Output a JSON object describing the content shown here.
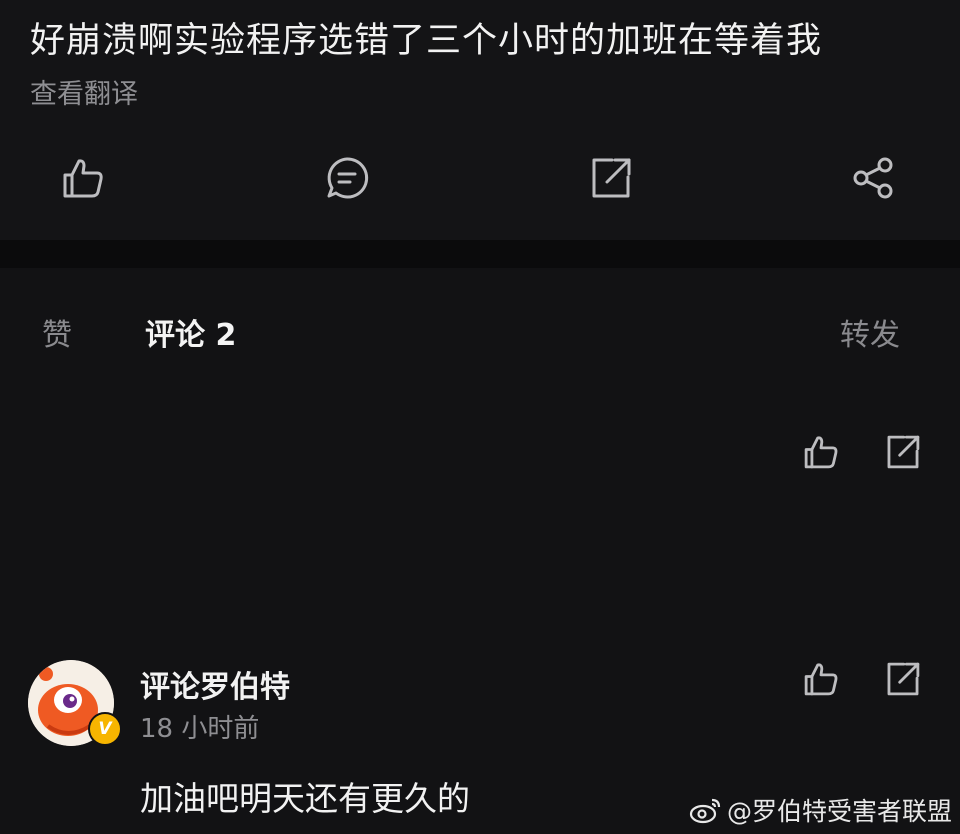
{
  "post": {
    "text": "好崩溃啊实验程序选错了三个小时的加班在等着我",
    "translate_label": "查看翻译"
  },
  "actions": {
    "like_icon": "thumbs-up-icon",
    "comment_icon": "comment-icon",
    "repost_icon": "repost-icon",
    "share_icon": "share-icon"
  },
  "tabs": {
    "like": "赞",
    "comments": "评论 2",
    "repost": "转发"
  },
  "comments": [
    {
      "name": "评论罗伯特",
      "time": "18 小时前",
      "text": "加油吧明天还有更久的",
      "verified_badge": "V"
    }
  ],
  "watermark": {
    "text": "@罗伯特受害者联盟",
    "icon": "weibo-icon"
  },
  "colors": {
    "background": "#121214",
    "text_primary": "#f2f2f2",
    "text_secondary": "#8e8e92",
    "badge": "#f7b500"
  }
}
